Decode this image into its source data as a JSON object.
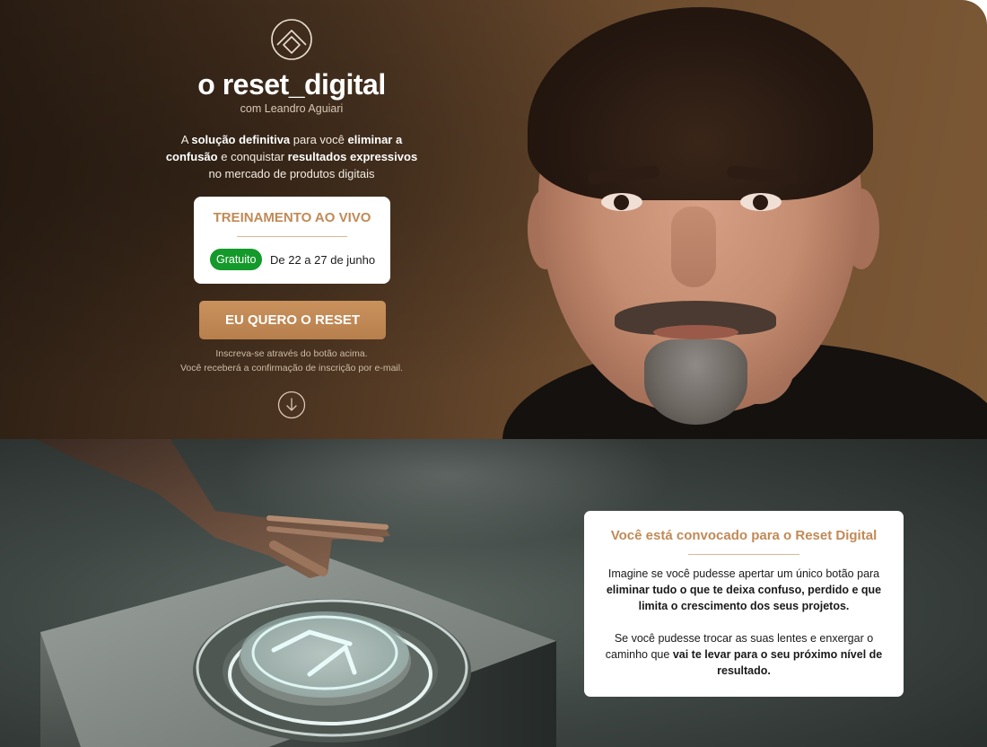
{
  "hero": {
    "logo_icon": "house-circle-logo-icon",
    "brand_title": "o reset_digital",
    "brand_subtitle": "com Leandro Aguiari",
    "description": {
      "t1": "A ",
      "b1": "solução definitiva",
      "t2": " para você ",
      "b2": "eliminar a confusão",
      "t3": " e conquistar ",
      "b3": "resultados expressivos",
      "t4": " no mercado de produtos digitais"
    },
    "event_card": {
      "title": "TREINAMENTO AO VIVO",
      "badge": "Gratuito",
      "dates": "De 22 a 27 de junho"
    },
    "cta_label": "EU QUERO O RESET",
    "cta_note_line1": "Inscreva-se através do botão acima.",
    "cta_note_line2": "Você receberá a confirmação de inscrição por e-mail.",
    "scroll_icon": "arrow-down-circle-icon"
  },
  "section2": {
    "card": {
      "title": "Você está convocado para o Reset Digital",
      "p1": {
        "t1": "Imagine se você pudesse apertar um único botão para ",
        "b1": "eliminar tudo o que te deixa confuso, perdido e que limita o crescimento dos seus projetos."
      },
      "p2": {
        "t1": "Se você pudesse trocar as suas lentes e enxergar o caminho que ",
        "b1": "vai te levar para o seu próximo nível de resultado."
      }
    }
  },
  "colors": {
    "accent": "#c08a56",
    "cta": "#c08a56",
    "badge_green": "#149a2a",
    "hero_bg": "#4b3421"
  }
}
